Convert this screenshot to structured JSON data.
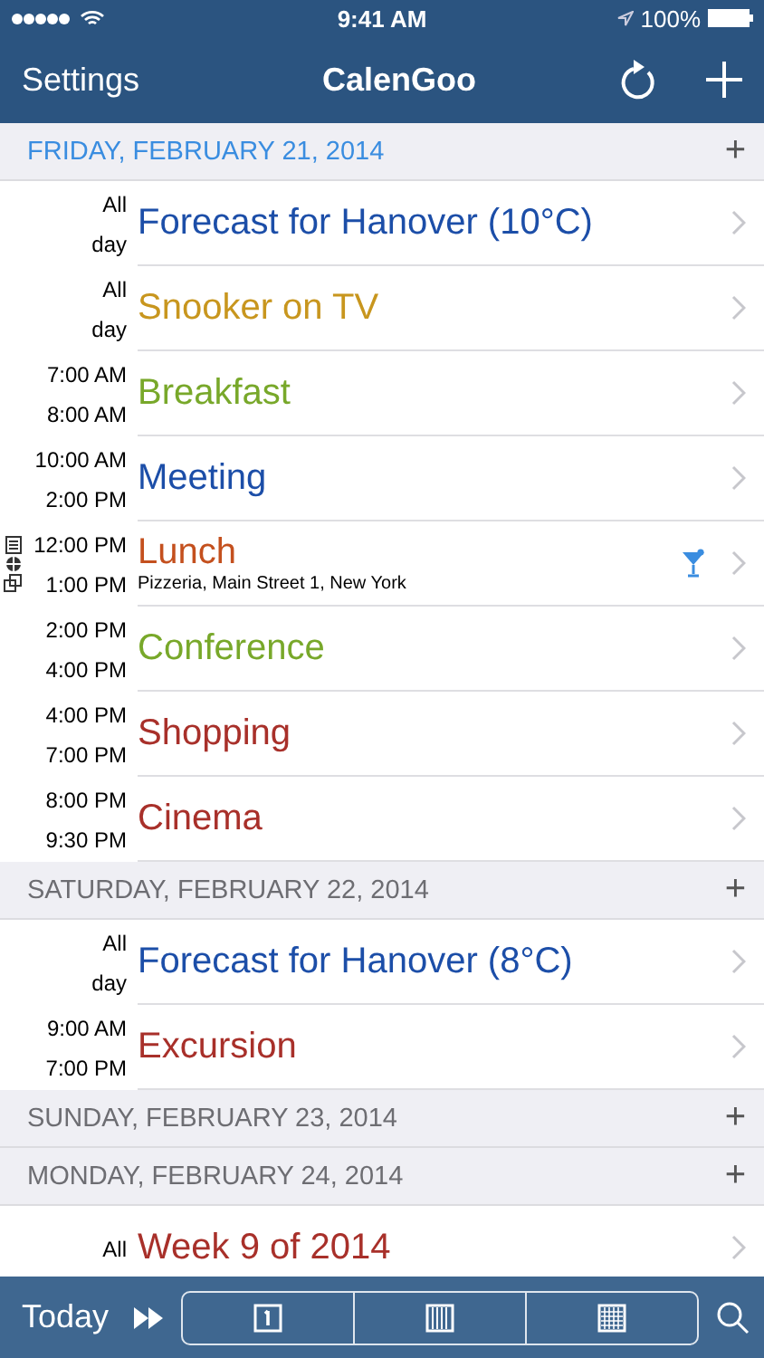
{
  "status_bar": {
    "time": "9:41 AM",
    "battery": "100%"
  },
  "nav": {
    "left": "Settings",
    "title": "CalenGoo"
  },
  "days": [
    {
      "label": "FRIDAY, FEBRUARY 21, 2014",
      "today": true,
      "add": "+",
      "events": [
        {
          "start": "All",
          "end": "day",
          "title": "Forecast for Hanover (10°C)",
          "color": "#1c4ea8"
        },
        {
          "start": "All",
          "end": "day",
          "title": "Snooker on TV",
          "color": "#c8961e"
        },
        {
          "start": "7:00 AM",
          "end": "8:00 AM",
          "title": "Breakfast",
          "color": "#78a82a"
        },
        {
          "start": "10:00 AM",
          "end": "2:00 PM",
          "title": "Meeting",
          "color": "#1c4ea8"
        },
        {
          "start": "12:00 PM",
          "end": "1:00 PM",
          "title": "Lunch",
          "color": "#c4501e",
          "location": "Pizzeria, Main Street 1, New York",
          "indicators": true,
          "drink": true
        },
        {
          "start": "2:00 PM",
          "end": "4:00 PM",
          "title": "Conference",
          "color": "#78a82a"
        },
        {
          "start": "4:00 PM",
          "end": "7:00 PM",
          "title": "Shopping",
          "color": "#a8302a"
        },
        {
          "start": "8:00 PM",
          "end": "9:30 PM",
          "title": "Cinema",
          "color": "#a8302a"
        }
      ]
    },
    {
      "label": "SATURDAY, FEBRUARY 22, 2014",
      "today": false,
      "add": "+",
      "events": [
        {
          "start": "All",
          "end": "day",
          "title": "Forecast for Hanover (8°C)",
          "color": "#1c4ea8"
        },
        {
          "start": "9:00 AM",
          "end": "7:00 PM",
          "title": "Excursion",
          "color": "#a8302a"
        }
      ]
    },
    {
      "label": "SUNDAY, FEBRUARY 23, 2014",
      "today": false,
      "add": "+"
    },
    {
      "label": "MONDAY, FEBRUARY 24, 2014",
      "today": false,
      "add": "+",
      "events": [
        {
          "start": "All",
          "title": "Week 9 of 2014",
          "color": "#a8302a"
        }
      ]
    }
  ],
  "toolbar": {
    "today": "Today"
  }
}
